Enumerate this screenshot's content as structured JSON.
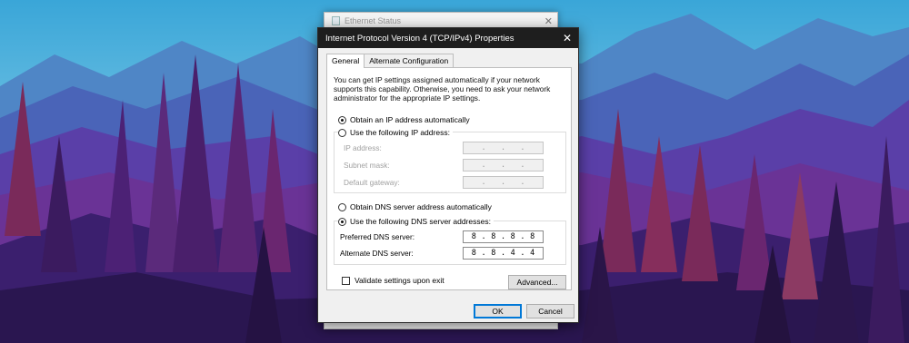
{
  "back_window": {
    "title": "Ethernet Status",
    "close_glyph": "✕"
  },
  "dialog": {
    "title": "Internet Protocol Version 4 (TCP/IPv4) Properties",
    "close_glyph": "✕",
    "tabs": [
      {
        "label": "General",
        "active": true
      },
      {
        "label": "Alternate Configuration",
        "active": false
      }
    ],
    "description": "You can get IP settings assigned automatically if your network supports this capability. Otherwise, you need to ask your network administrator for the appropriate IP settings.",
    "ip_section": {
      "auto_label": "Obtain an IP address automatically",
      "auto_selected": true,
      "manual_label": "Use the following IP address:",
      "manual_selected": false,
      "fields": [
        {
          "label": "IP address:",
          "octets": [
            "",
            "",
            "",
            ""
          ],
          "separators": [
            ".",
            ".",
            "."
          ]
        },
        {
          "label": "Subnet mask:",
          "octets": [
            "",
            "",
            "",
            ""
          ],
          "separators": [
            ".",
            ".",
            "."
          ]
        },
        {
          "label": "Default gateway:",
          "octets": [
            "",
            "",
            "",
            ""
          ],
          "separators": [
            ".",
            ".",
            "."
          ]
        }
      ]
    },
    "dns_section": {
      "auto_label": "Obtain DNS server address automatically",
      "auto_selected": false,
      "manual_label": "Use the following DNS server addresses:",
      "manual_selected": true,
      "fields": [
        {
          "label": "Preferred DNS server:",
          "octets": [
            "8",
            "8",
            "8",
            "8"
          ],
          "separators": [
            ".",
            ".",
            "."
          ]
        },
        {
          "label": "Alternate DNS server:",
          "octets": [
            "8",
            "8",
            "4",
            "4"
          ],
          "separators": [
            ".",
            ".",
            "."
          ]
        }
      ]
    },
    "validate_label": "Validate settings upon exit",
    "validate_checked": false,
    "advanced_label": "Advanced...",
    "ok_label": "OK",
    "cancel_label": "Cancel"
  },
  "colors": {
    "titlebar": "#1e1e1e",
    "dialog_bg": "#f0f0f0",
    "accent": "#0078d7"
  }
}
